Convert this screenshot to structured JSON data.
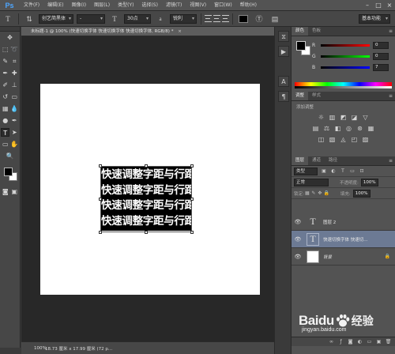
{
  "app": {
    "logo": "Ps",
    "menu": [
      "文件(F)",
      "编辑(E)",
      "图像(I)",
      "图层(L)",
      "类型(Y)",
      "选择(S)",
      "滤镜(T)",
      "视图(V)",
      "窗口(W)",
      "帮助(H)"
    ],
    "window_controls": [
      "–",
      "□",
      "×"
    ]
  },
  "options_bar": {
    "font_family": "创艺简黑体",
    "font_style": "-",
    "font_size": "30点",
    "aa_label": "a",
    "antialias": "锐利",
    "text_color": "#000000",
    "workspace": "基本功能"
  },
  "document": {
    "tab_title": "未标题-1 @ 100% (快速切换字体 快速切换字体 快速切换字体, RGB/8) *",
    "close": "×",
    "canvas_text": [
      "快速调整字距与行距",
      "快速调整字距与行距",
      "快速调整字距与行距",
      "快速调整字距与行距"
    ]
  },
  "status_bar": {
    "zoom": "100%",
    "info": "18.73 厘米 x 17.99 厘米 (72 p..."
  },
  "color_panel": {
    "tabs": [
      "颜色",
      "色板"
    ],
    "sliders": [
      {
        "label": "R",
        "value": "0",
        "gradient": "linear-gradient(to right,#000,#ff0000)"
      },
      {
        "label": "G",
        "value": "0",
        "gradient": "linear-gradient(to right,#000,#00ff00)"
      },
      {
        "label": "B",
        "value": "7",
        "gradient": "linear-gradient(to right,#000,#0000ff)"
      }
    ]
  },
  "adjust_panel": {
    "tabs": [
      "调整",
      "样式"
    ],
    "hint": "添加调整"
  },
  "layers_panel": {
    "tabs": [
      "图层",
      "通道",
      "路径"
    ],
    "kind": "类型",
    "blend_mode": "正常",
    "opacity_label": "不透明度:",
    "opacity": "100%",
    "lock_label": "锁定:",
    "fill_label": "填充:",
    "fill": "100%",
    "layers": [
      {
        "name": "图层 2",
        "thumb": "T"
      },
      {
        "name": "快速切换字体 快速切...",
        "thumb": "T"
      },
      {
        "name": "背景",
        "thumb": ""
      }
    ]
  },
  "watermark": {
    "brand": "Baidu",
    "jingyan": "经验",
    "url": "jingyan.baidu.com"
  }
}
